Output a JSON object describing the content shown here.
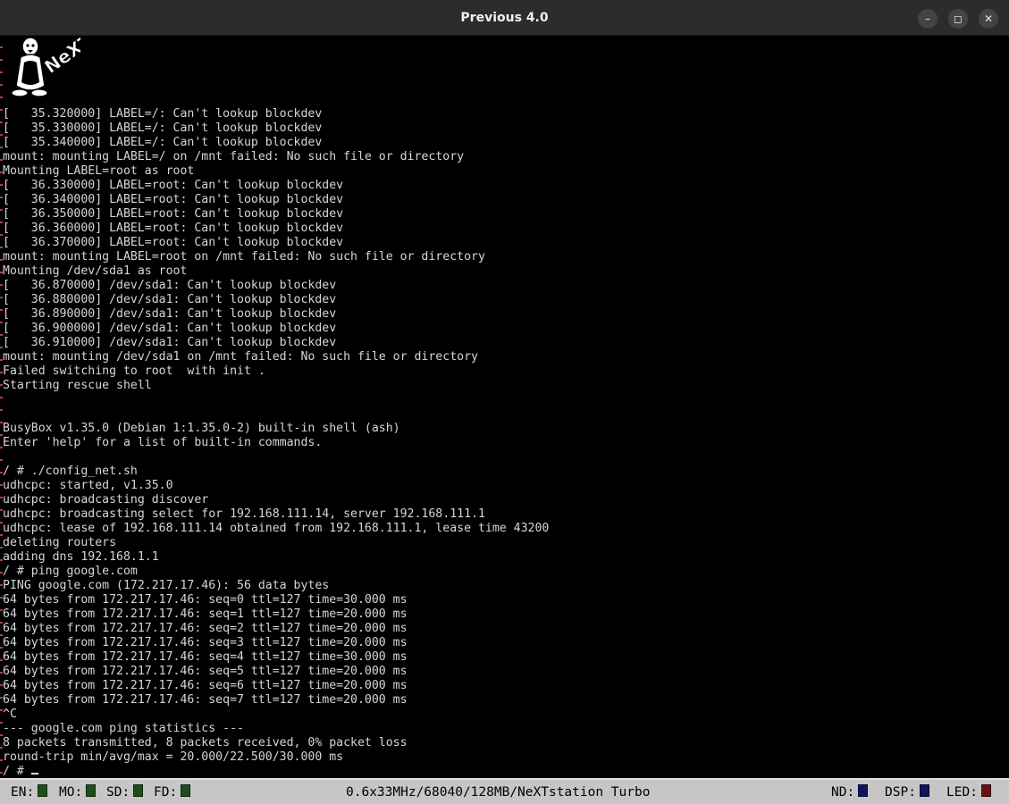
{
  "window": {
    "title": "Previous 4.0",
    "controls": {
      "minimize": "–",
      "maximize": "◻",
      "close": "✕"
    }
  },
  "logo": {
    "icon": "tux-next-logo-icon",
    "text": "NeXT"
  },
  "console": {
    "lines": [
      "[   35.320000] LABEL=/: Can't lookup blockdev",
      "[   35.330000] LABEL=/: Can't lookup blockdev",
      "[   35.340000] LABEL=/: Can't lookup blockdev",
      "mount: mounting LABEL=/ on /mnt failed: No such file or directory",
      "Mounting LABEL=root as root",
      "[   36.330000] LABEL=root: Can't lookup blockdev",
      "[   36.340000] LABEL=root: Can't lookup blockdev",
      "[   36.350000] LABEL=root: Can't lookup blockdev",
      "[   36.360000] LABEL=root: Can't lookup blockdev",
      "[   36.370000] LABEL=root: Can't lookup blockdev",
      "mount: mounting LABEL=root on /mnt failed: No such file or directory",
      "Mounting /dev/sda1 as root",
      "[   36.870000] /dev/sda1: Can't lookup blockdev",
      "[   36.880000] /dev/sda1: Can't lookup blockdev",
      "[   36.890000] /dev/sda1: Can't lookup blockdev",
      "[   36.900000] /dev/sda1: Can't lookup blockdev",
      "[   36.910000] /dev/sda1: Can't lookup blockdev",
      "mount: mounting /dev/sda1 on /mnt failed: No such file or directory",
      "Failed switching to root  with init .",
      "Starting rescue shell",
      "",
      "",
      "BusyBox v1.35.0 (Debian 1:1.35.0-2) built-in shell (ash)",
      "Enter 'help' for a list of built-in commands.",
      "",
      "/ # ./config_net.sh",
      "udhcpc: started, v1.35.0",
      "udhcpc: broadcasting discover",
      "udhcpc: broadcasting select for 192.168.111.14, server 192.168.111.1",
      "udhcpc: lease of 192.168.111.14 obtained from 192.168.111.1, lease time 43200",
      "deleting routers",
      "adding dns 192.168.1.1",
      "/ # ping google.com",
      "PING google.com (172.217.17.46): 56 data bytes",
      "64 bytes from 172.217.17.46: seq=0 ttl=127 time=30.000 ms",
      "64 bytes from 172.217.17.46: seq=1 ttl=127 time=20.000 ms",
      "64 bytes from 172.217.17.46: seq=2 ttl=127 time=20.000 ms",
      "64 bytes from 172.217.17.46: seq=3 ttl=127 time=20.000 ms",
      "64 bytes from 172.217.17.46: seq=4 ttl=127 time=30.000 ms",
      "64 bytes from 172.217.17.46: seq=5 ttl=127 time=20.000 ms",
      "64 bytes from 172.217.17.46: seq=6 ttl=127 time=20.000 ms",
      "64 bytes from 172.217.17.46: seq=7 ttl=127 time=20.000 ms",
      "^C",
      "--- google.com ping statistics ---",
      "8 packets transmitted, 8 packets received, 0% packet loss",
      "round-trip min/avg/max = 20.000/22.500/30.000 ms"
    ],
    "prompt": "/ # "
  },
  "statusbar": {
    "en_label": "EN:",
    "mo_label": "MO:",
    "sd_label": "SD:",
    "fd_label": "FD:",
    "machine_info": "0.6x33MHz/68040/128MB/NeXTstation Turbo",
    "nd_label": "ND:",
    "dsp_label": "DSP:",
    "led_label": "LED:",
    "colors": {
      "green_led": "#1f4d1f",
      "blue_led": "#14145a",
      "red_led": "#6a1010",
      "bar": "#c6c6c6"
    }
  }
}
